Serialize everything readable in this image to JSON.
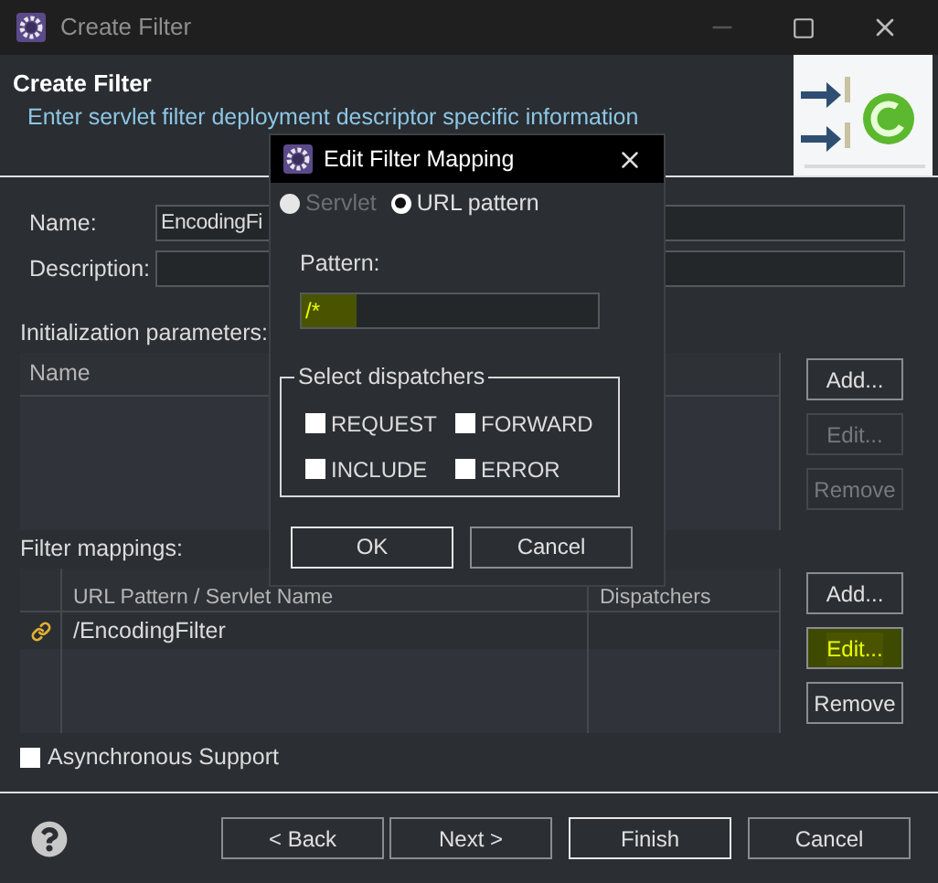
{
  "window": {
    "title": "Create Filter"
  },
  "header": {
    "title": "Create Filter",
    "description": "Enter servlet filter deployment descriptor specific information"
  },
  "fields": [
    {
      "label": "Name:",
      "value": "EncodingFi"
    },
    {
      "label": "Description:"
    }
  ],
  "init_params": {
    "label": "Initialization parameters:",
    "columns": [
      "Name"
    ],
    "buttons": [
      {
        "label": "Add...",
        "disabled": false,
        "highlighted": false
      },
      {
        "label": "Edit...",
        "disabled": true,
        "highlighted": false
      },
      {
        "label": "Remove",
        "disabled": true,
        "highlighted": false
      }
    ]
  },
  "filter_mappings": {
    "label": "Filter mappings:",
    "columns": [
      "URL Pattern / Servlet Name",
      "Dispatchers"
    ],
    "rows": [
      {
        "pattern": "/EncodingFilter"
      }
    ],
    "buttons": [
      {
        "label": "Add...",
        "disabled": false,
        "highlighted": false
      },
      {
        "label": "Edit...",
        "disabled": false,
        "highlighted": true
      },
      {
        "label": "Remove",
        "disabled": false,
        "highlighted": false
      }
    ]
  },
  "async_support": {
    "label": "Asynchronous Support",
    "checked": false
  },
  "footer_buttons": [
    {
      "label": "< Back",
      "default": false
    },
    {
      "label": "Next >",
      "default": false
    },
    {
      "label": "Finish",
      "default": true
    },
    {
      "label": "Cancel",
      "default": false
    }
  ],
  "dialog": {
    "title": "Edit Filter Mapping",
    "options": [
      {
        "label": "Servlet",
        "selected": false,
        "disabled": true
      },
      {
        "label": "URL pattern",
        "selected": true,
        "disabled": false
      }
    ],
    "pattern_label": "Pattern:",
    "pattern_value": "/*",
    "pattern_highlighted": true,
    "group_label": "Select dispatchers",
    "dispatchers": [
      {
        "label": "REQUEST",
        "checked": false
      },
      {
        "label": "FORWARD",
        "checked": false
      },
      {
        "label": "INCLUDE",
        "checked": false
      },
      {
        "label": "ERROR",
        "checked": false
      }
    ],
    "buttons": [
      {
        "label": "OK",
        "default": true
      },
      {
        "label": "Cancel",
        "default": false
      }
    ]
  }
}
